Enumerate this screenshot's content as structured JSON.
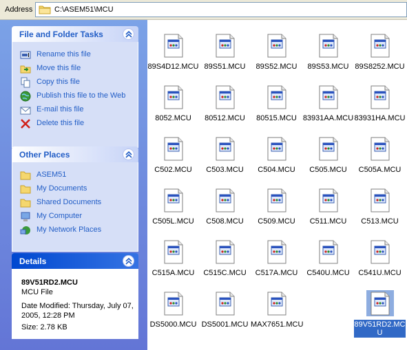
{
  "address": {
    "label": "Address",
    "path": "C:\\ASEM51\\MCU"
  },
  "tasks": {
    "title": "File and Folder Tasks",
    "items": [
      {
        "label": "Rename this file",
        "icon": "rename-icon"
      },
      {
        "label": "Move this file",
        "icon": "move-icon"
      },
      {
        "label": "Copy this file",
        "icon": "copy-icon"
      },
      {
        "label": "Publish this file to the Web",
        "icon": "globe-icon"
      },
      {
        "label": "E-mail this file",
        "icon": "email-icon"
      },
      {
        "label": "Delete this file",
        "icon": "delete-icon"
      }
    ]
  },
  "places": {
    "title": "Other Places",
    "items": [
      {
        "label": "ASEM51",
        "icon": "folder-icon"
      },
      {
        "label": "My Documents",
        "icon": "folder-icon"
      },
      {
        "label": "Shared Documents",
        "icon": "folder-icon"
      },
      {
        "label": "My Computer",
        "icon": "computer-icon"
      },
      {
        "label": "My Network Places",
        "icon": "network-icon"
      }
    ]
  },
  "details": {
    "title": "Details",
    "name": "89V51RD2.MCU",
    "type": "MCU File",
    "modified": "Date Modified: Thursday, July 07, 2005, 12:28 PM",
    "size": "Size: 2.78 KB"
  },
  "files": [
    "89S4D12.MCU",
    "89S51.MCU",
    "89S52.MCU",
    "89S53.MCU",
    "89S8252.MCU",
    "8052.MCU",
    "80512.MCU",
    "80515.MCU",
    "83931AA.MCU",
    "83931HA.MCU",
    "C502.MCU",
    "C503.MCU",
    "C504.MCU",
    "C505.MCU",
    "C505A.MCU",
    "C505L.MCU",
    "C508.MCU",
    "C509.MCU",
    "C511.MCU",
    "C513.MCU",
    "C515A.MCU",
    "C515C.MCU",
    "C517A.MCU",
    "C540U.MCU",
    "C541U.MCU",
    "DS5000.MCU",
    "DS5001.MCU",
    "MAX7651.MCU",
    "",
    "89V51RD2.MCU"
  ],
  "selected_file": "89V51RD2.MCU",
  "colors": {
    "taskpane_top": "#7ba2e7",
    "taskpane_bottom": "#6375d6",
    "link": "#215dc6",
    "selection": "#3169c6"
  }
}
